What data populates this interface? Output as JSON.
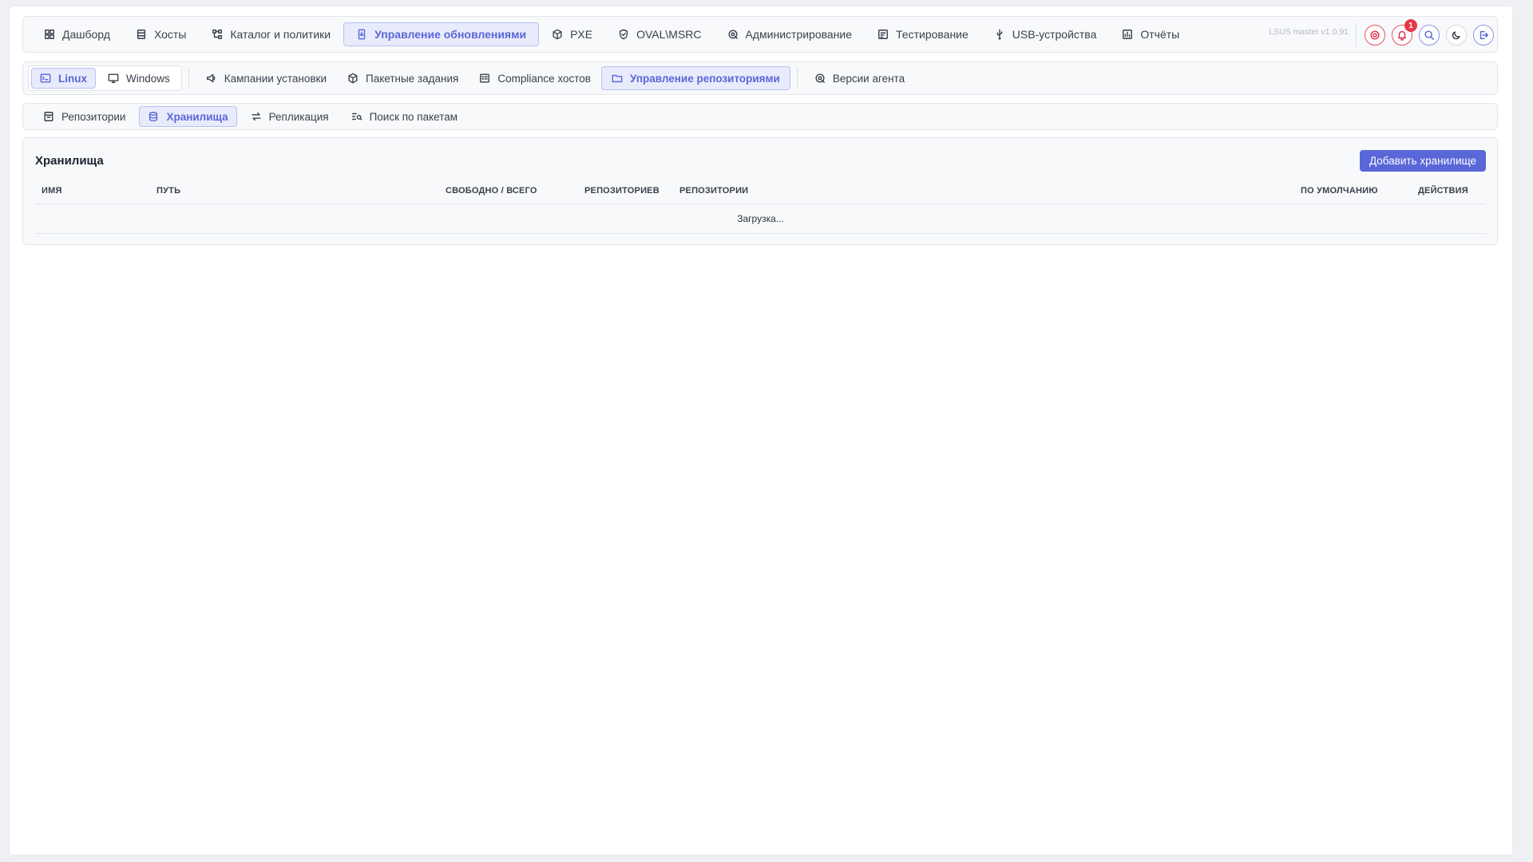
{
  "top_nav": {
    "items": [
      {
        "label": "Дашборд",
        "icon": "grid-icon"
      },
      {
        "label": "Хосты",
        "icon": "server-icon"
      },
      {
        "label": "Каталог и политики",
        "icon": "hierarchy-icon"
      },
      {
        "label": "Управление обновлениями",
        "icon": "update-icon",
        "active": true
      },
      {
        "label": "PXE",
        "icon": "cube-icon"
      },
      {
        "label": "OVAL\\MSRC",
        "icon": "shield-icon"
      },
      {
        "label": "Администрирование",
        "icon": "admin-gear-icon"
      },
      {
        "label": "Тестирование",
        "icon": "test-icon"
      },
      {
        "label": "USB-устройства",
        "icon": "usb-icon"
      },
      {
        "label": "Отчёты",
        "icon": "report-icon"
      }
    ],
    "version": "LSUS master v1.0.91",
    "notification_count": "1"
  },
  "os_switch": {
    "items": [
      {
        "label": "Linux",
        "icon": "terminal-icon",
        "active": true
      },
      {
        "label": "Windows",
        "icon": "monitor-icon"
      }
    ]
  },
  "sub_nav": {
    "items": [
      {
        "label": "Кампании установки",
        "icon": "megaphone-icon"
      },
      {
        "label": "Пакетные задания",
        "icon": "package-icon"
      },
      {
        "label": "Compliance хостов",
        "icon": "compliance-icon"
      },
      {
        "label": "Управление репозиториями",
        "icon": "folder-icon",
        "active": true
      },
      {
        "label": "Версии агента",
        "icon": "agent-icon"
      }
    ]
  },
  "tabs": {
    "items": [
      {
        "label": "Репозитории",
        "icon": "archive-icon"
      },
      {
        "label": "Хранилища",
        "icon": "database-icon",
        "active": true
      },
      {
        "label": "Репликация",
        "icon": "replicate-icon"
      },
      {
        "label": "Поиск по пакетам",
        "icon": "search-list-icon"
      }
    ]
  },
  "panel": {
    "title": "Хранилища",
    "add_button": "Добавить хранилище",
    "columns": {
      "name": "ИМЯ",
      "path": "ПУТЬ",
      "free_total": "СВОБОДНО / ВСЕГО",
      "repo_count": "РЕПОЗИТОРИЕВ",
      "repos": "РЕПОЗИТОРИИ",
      "default": "ПО УМОЛЧАНИЮ",
      "actions": "ДЕЙСТВИЯ"
    },
    "loading": "Загрузка..."
  },
  "colors": {
    "accent": "#5a67d8",
    "accent_bg": "#e8ebfb",
    "danger": "#e53946"
  }
}
